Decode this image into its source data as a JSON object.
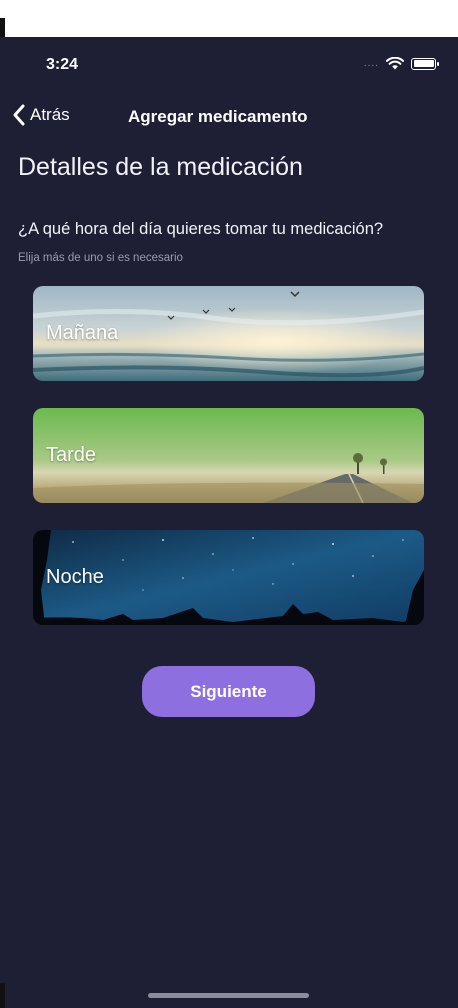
{
  "status_bar": {
    "time": "3:24",
    "signal_dots": "...."
  },
  "nav": {
    "back_label": "Atrás",
    "title": "Agregar medicamento"
  },
  "content": {
    "heading": "Detalles de la medicación",
    "question": "¿A qué hora del día quieres tomar tu medicación?",
    "hint": "Elija más de uno si es necesario"
  },
  "options": [
    {
      "label": "Mañana",
      "icon": "sunrise-seascape-image"
    },
    {
      "label": "Tarde",
      "icon": "countryside-road-image"
    },
    {
      "label": "Noche",
      "icon": "starry-night-image"
    }
  ],
  "actions": {
    "next_label": "Siguiente"
  },
  "colors": {
    "background": "#1e1f35",
    "accent_button": "#8e6fe0",
    "text_primary": "#f2f2f6",
    "text_secondary": "#9a9bb0"
  }
}
